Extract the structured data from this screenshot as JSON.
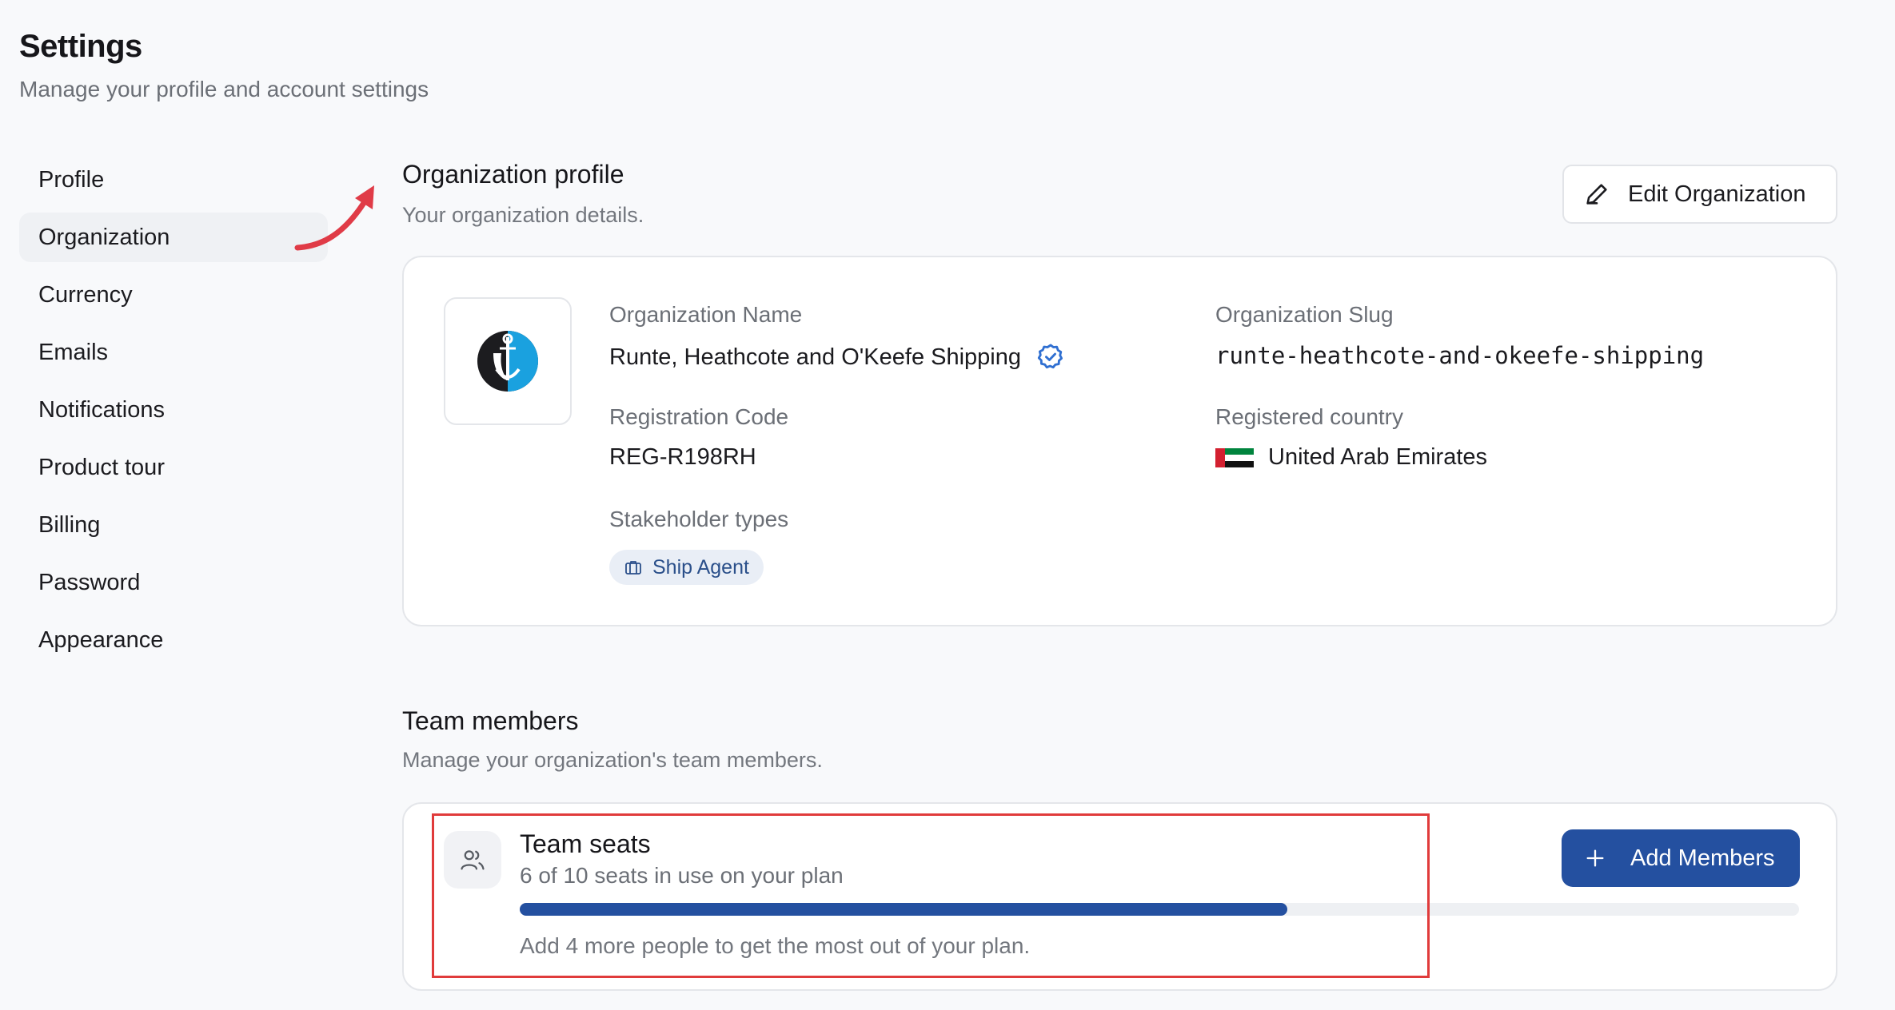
{
  "header": {
    "title": "Settings",
    "subtitle": "Manage your profile and account settings"
  },
  "sidebar": {
    "items": [
      {
        "label": "Profile"
      },
      {
        "label": "Organization",
        "active": true
      },
      {
        "label": "Currency"
      },
      {
        "label": "Emails"
      },
      {
        "label": "Notifications"
      },
      {
        "label": "Product tour"
      },
      {
        "label": "Billing"
      },
      {
        "label": "Password"
      },
      {
        "label": "Appearance"
      }
    ]
  },
  "org_profile": {
    "title": "Organization profile",
    "subtitle": "Your organization details.",
    "edit_label": "Edit Organization",
    "name_label": "Organization Name",
    "name_value": "Runte, Heathcote and O'Keefe Shipping",
    "slug_label": "Organization Slug",
    "slug_value": "runte-heathcote-and-okeefe-shipping",
    "reg_code_label": "Registration Code",
    "reg_code_value": "REG-R198RH",
    "country_label": "Registered country",
    "country_value": "United Arab Emirates",
    "stakeholder_label": "Stakeholder types",
    "stakeholder_tag": "Ship Agent",
    "icons": [
      "pencil-icon",
      "verified-badge-icon",
      "uae-flag-icon",
      "briefcase-icon",
      "anchor-logo"
    ]
  },
  "team": {
    "title": "Team members",
    "subtitle": "Manage your organization's team members.",
    "seats_title": "Team seats",
    "seats_sub": "6 of 10 seats in use on your plan",
    "seats_used": 6,
    "seats_total": 10,
    "note": "Add 4 more people to get the most out of your plan.",
    "add_label": "Add Members"
  },
  "colors": {
    "accent": "#2450a0",
    "highlight": "#e03b3b",
    "verified": "#2f6fd1"
  }
}
